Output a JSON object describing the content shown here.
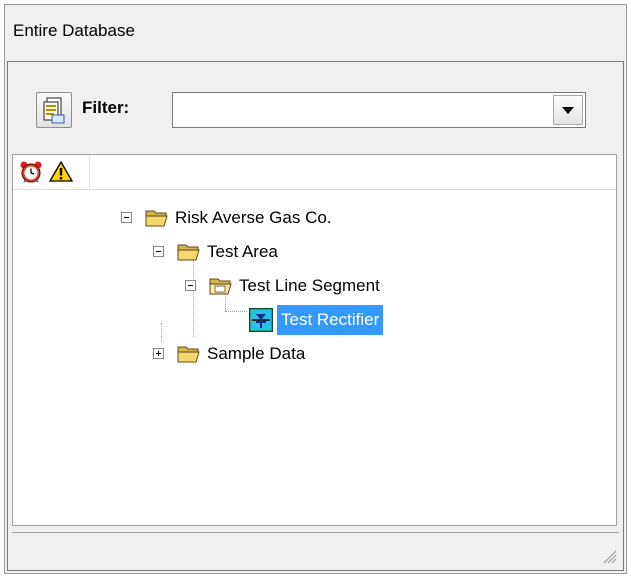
{
  "window": {
    "title": "Entire Database"
  },
  "toolbar": {
    "filter_button_icon": "report-icon",
    "filter_label": "Filter:",
    "filter_value": ""
  },
  "tree": {
    "header_icons": [
      "alarm-clock-icon",
      "warning-icon"
    ],
    "nodes": [
      {
        "label": "Risk Averse Gas Co.",
        "icon": "folder-open-icon",
        "expander": "minus"
      },
      {
        "label": "Test Area",
        "icon": "folder-open-icon",
        "expander": "minus"
      },
      {
        "label": "Test Line Segment",
        "icon": "folder-open-icon",
        "expander": "minus"
      },
      {
        "label": "Test Rectifier",
        "icon": "rectifier-icon",
        "selected": true
      },
      {
        "label": "Sample Data",
        "icon": "folder-open-icon",
        "expander": "plus"
      }
    ]
  },
  "colors": {
    "selection": "#3399ff",
    "folder": "#f5d76e",
    "window_bg": "#f0f0f0"
  }
}
